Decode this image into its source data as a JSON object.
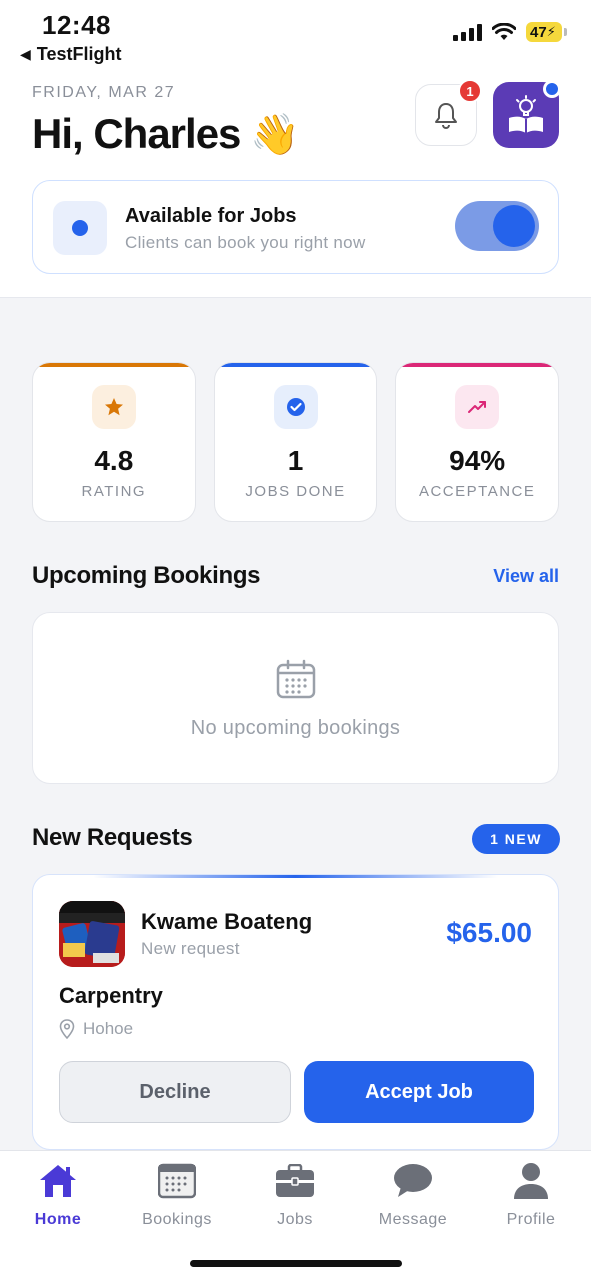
{
  "status_bar": {
    "time": "12:48",
    "back_label": "TestFlight",
    "battery": "47"
  },
  "header": {
    "date": "FRIDAY, MAR 27",
    "greeting": "Hi, Charles",
    "wave_emoji": "👋",
    "notification_count": "1"
  },
  "availability": {
    "title": "Available for Jobs",
    "subtitle": "Clients can book you right now",
    "enabled": true
  },
  "stats": [
    {
      "value": "4.8",
      "label": "RATING",
      "icon": "star-icon",
      "accent": "#d97706"
    },
    {
      "value": "1",
      "label": "JOBS DONE",
      "icon": "check-circle-icon",
      "accent": "#2563eb"
    },
    {
      "value": "94%",
      "label": "ACCEPTANCE",
      "icon": "trending-up-icon",
      "accent": "#db2777"
    }
  ],
  "upcoming": {
    "title": "Upcoming Bookings",
    "view_all": "View all",
    "empty_text": "No upcoming bookings"
  },
  "requests": {
    "title": "New Requests",
    "badge": "1 NEW",
    "items": [
      {
        "client": "Kwame Boateng",
        "status": "New request",
        "price": "$65.00",
        "category": "Carpentry",
        "location": "Hohoe",
        "decline_label": "Decline",
        "accept_label": "Accept Job"
      }
    ]
  },
  "tabs": [
    {
      "label": "Home",
      "icon": "home-icon",
      "active": true
    },
    {
      "label": "Bookings",
      "icon": "calendar-icon",
      "active": false
    },
    {
      "label": "Jobs",
      "icon": "briefcase-icon",
      "active": false
    },
    {
      "label": "Message",
      "icon": "chat-bubble-icon",
      "active": false
    },
    {
      "label": "Profile",
      "icon": "person-icon",
      "active": false
    }
  ],
  "colors": {
    "primary": "#2563eb",
    "active_tab": "#4a3ad6",
    "badge_red": "#e53935"
  }
}
